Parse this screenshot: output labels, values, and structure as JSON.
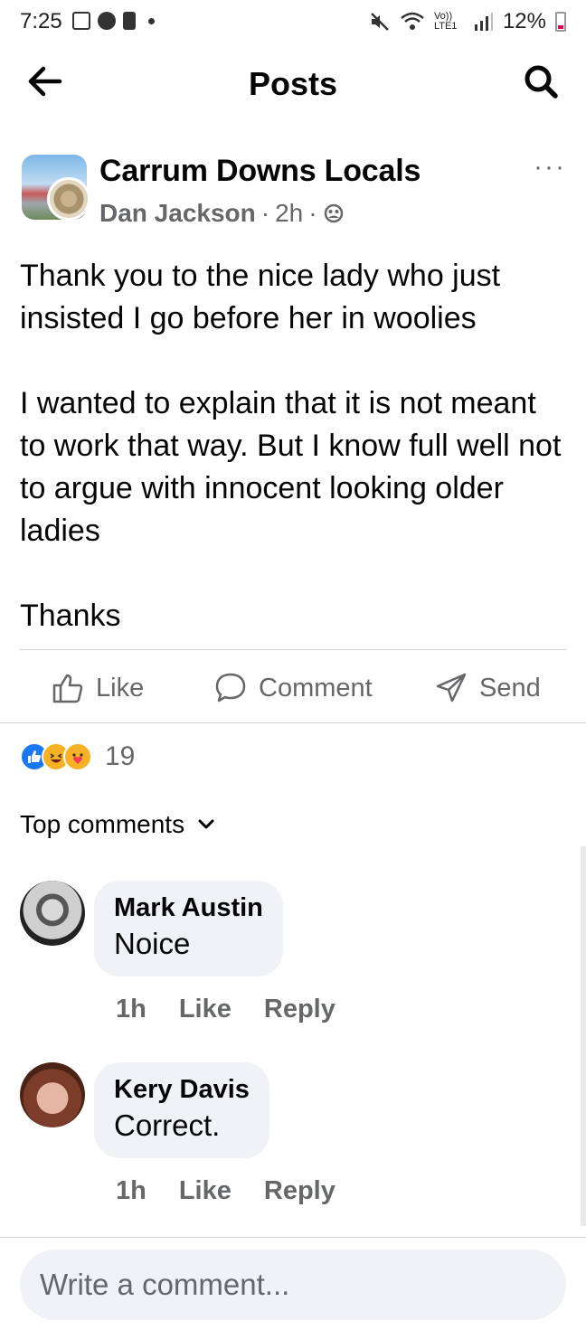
{
  "status_bar": {
    "time": "7:25",
    "battery": "12%",
    "network_label": "Vo)) LTE1"
  },
  "header": {
    "title": "Posts",
    "back_icon": "arrow-left-icon",
    "search_icon": "search-icon"
  },
  "post": {
    "group_name": "Carrum Downs Locals",
    "author": "Dan Jackson",
    "time": "2h",
    "separator": "·",
    "body": "Thank you to the nice lady who just insisted I go before her in woolies\n\nI wanted to explain that it is not meant to work that way. But I know full well not to argue with innocent looking older ladies\n\nThanks",
    "more_label": "···"
  },
  "actions": {
    "like": "Like",
    "comment": "Comment",
    "send": "Send"
  },
  "reactions": {
    "count": "19",
    "types": [
      "like",
      "haha",
      "care"
    ]
  },
  "comments_sort": {
    "label": "Top comments"
  },
  "comments": [
    {
      "name": "Mark Austin",
      "text": "Noice",
      "time": "1h",
      "like_label": "Like",
      "reply_label": "Reply"
    },
    {
      "name": "Kery Davis",
      "text": "Correct.",
      "time": "1h",
      "like_label": "Like",
      "reply_label": "Reply"
    }
  ],
  "composer": {
    "placeholder": "Write a comment..."
  },
  "colors": {
    "accent": "#1877f2",
    "secondary_text": "#65676b",
    "bubble": "#f0f2f5"
  }
}
